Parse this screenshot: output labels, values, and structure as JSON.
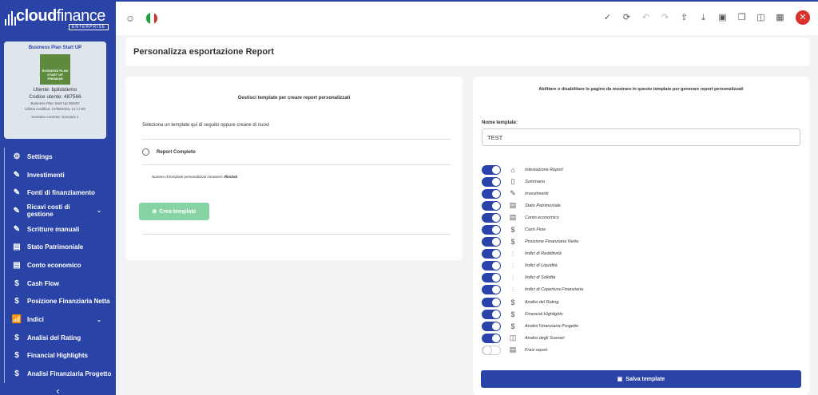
{
  "sidebar": {
    "logo": {
      "main": "cloud",
      "light": "finance",
      "tag": "ENTERPRISE"
    },
    "card": {
      "plan_title": "Business Plan Start UP",
      "badge_line1": "BUSINESS PLAN",
      "badge_line2": "START UP",
      "badge_line3": "PREMIUM",
      "user": "Utente: bpilotdemo",
      "code": "Codice utente: 487566",
      "plan_name": "Business Plan Start Up DEMO",
      "last_edit": "Ultima modifica: 27/08/2025, 11:17:59",
      "scenario": "Scenario corrente: Scenario 1"
    },
    "items": [
      {
        "label": "Settings",
        "icon": "gear-icon",
        "glyph": "⚙"
      },
      {
        "label": "Investimenti",
        "icon": "edit-icon",
        "glyph": "✎"
      },
      {
        "label": "Fonti di finanziamento",
        "icon": "edit-icon",
        "glyph": "✎"
      },
      {
        "label": "Ricavi costi di gestione",
        "icon": "edit-icon",
        "glyph": "✎",
        "chevron": "⌄"
      },
      {
        "label": "Scritture manuali",
        "icon": "edit-icon",
        "glyph": "✎"
      },
      {
        "label": "Stato Patrimoniale",
        "icon": "document-icon",
        "glyph": "▤"
      },
      {
        "label": "Conto economico",
        "icon": "document-icon",
        "glyph": "▤"
      },
      {
        "label": "Cash Flow",
        "icon": "dollar-icon",
        "glyph": "$"
      },
      {
        "label": "Posizione Finanziaria Netta",
        "icon": "dollar-icon",
        "glyph": "$"
      },
      {
        "label": "Indici",
        "icon": "bar-chart-icon",
        "glyph": "📶",
        "chevron": "⌄"
      },
      {
        "label": "Analisi del Rating",
        "icon": "dollar-icon",
        "glyph": "$"
      },
      {
        "label": "Financial Highlights",
        "icon": "dollar-icon",
        "glyph": "$"
      },
      {
        "label": "Analisi Finanziaria Progetto",
        "icon": "dollar-icon",
        "glyph": "$"
      }
    ],
    "collapse_glyph": "‹"
  },
  "topbar": {
    "left_icons": [
      {
        "icon": "face-icon",
        "glyph": "☺"
      }
    ],
    "flag_colors": [
      "#1f9d3a",
      "#ffffff",
      "#d9302c"
    ],
    "right_icons": [
      {
        "icon": "check-icon",
        "glyph": "✓",
        "dim": false
      },
      {
        "icon": "refresh-icon",
        "glyph": "⟳",
        "dim": false
      },
      {
        "icon": "undo-icon",
        "glyph": "↶",
        "dim": true
      },
      {
        "icon": "redo-icon",
        "glyph": "↷",
        "dim": true
      },
      {
        "icon": "upload-icon",
        "glyph": "⇪",
        "dim": false
      },
      {
        "icon": "download-icon",
        "glyph": "⤓",
        "dim": false
      },
      {
        "icon": "save-icon",
        "glyph": "▣",
        "dim": false
      },
      {
        "icon": "copy-icon",
        "glyph": "❐",
        "dim": false
      },
      {
        "icon": "columns-icon",
        "glyph": "◫",
        "dim": false
      },
      {
        "icon": "layout-icon",
        "glyph": "▦",
        "dim": false
      }
    ],
    "close_glyph": "✕"
  },
  "page_title": "Personalizza esportazione Report",
  "left_panel": {
    "title": "Gestisci template per creare report personalizzati",
    "subtitle": "Seleziona un template qui di seguito oppure creane di nuovi",
    "option": "Report Completo",
    "note_prefix": "Numero di template personalizzati rimanenti: ",
    "note_value": "Illimitati",
    "create_label": "Crea template",
    "create_glyph": "⊕"
  },
  "right_panel": {
    "title": "Abilitare o disabilitare le pagine da mostrare in questo template per generare report personalizzati",
    "name_label": "Nome template:",
    "name_value": "TEST",
    "pages": [
      {
        "label": "Intestazione Report",
        "enabled": true,
        "icon": "home-icon",
        "glyph": "⌂"
      },
      {
        "label": "Sommario",
        "enabled": true,
        "icon": "book-icon",
        "glyph": "▯"
      },
      {
        "label": "Investimenti",
        "enabled": true,
        "icon": "edit-icon",
        "glyph": "✎"
      },
      {
        "label": "Stato Patrimoniale",
        "enabled": true,
        "icon": "document-icon",
        "glyph": "▤"
      },
      {
        "label": "Conto economico",
        "enabled": true,
        "icon": "document-icon",
        "glyph": "▤"
      },
      {
        "label": "Cash Flow",
        "enabled": true,
        "icon": "dollar-icon",
        "glyph": "$"
      },
      {
        "label": "Posizione Finanziaria Netta",
        "enabled": true,
        "icon": "dollar-icon",
        "glyph": "$"
      },
      {
        "label": "Indici di Redditività",
        "enabled": true,
        "icon": "bar-chart-icon",
        "glyph": "⫶"
      },
      {
        "label": "Indici di Liquidità",
        "enabled": true,
        "icon": "bar-chart-icon",
        "glyph": "⫶"
      },
      {
        "label": "Indici di Solidità",
        "enabled": true,
        "icon": "bar-chart-icon",
        "glyph": "⫶"
      },
      {
        "label": "Indici di Copertura Finanziaria",
        "enabled": true,
        "icon": "bar-chart-icon",
        "glyph": "⫶"
      },
      {
        "label": "Analisi del Rating",
        "enabled": true,
        "icon": "dollar-icon",
        "glyph": "$"
      },
      {
        "label": "Financial Highlights",
        "enabled": true,
        "icon": "dollar-icon",
        "glyph": "$"
      },
      {
        "label": "Analisi Finanziaria Progetto",
        "enabled": true,
        "icon": "dollar-icon",
        "glyph": "$"
      },
      {
        "label": "Analisi degli Scenari",
        "enabled": true,
        "icon": "columns-icon",
        "glyph": "◫"
      },
      {
        "label": "Frasi report",
        "enabled": false,
        "icon": "document-icon",
        "glyph": "▤"
      }
    ],
    "save_label": "Salva template",
    "save_glyph": "▣"
  }
}
